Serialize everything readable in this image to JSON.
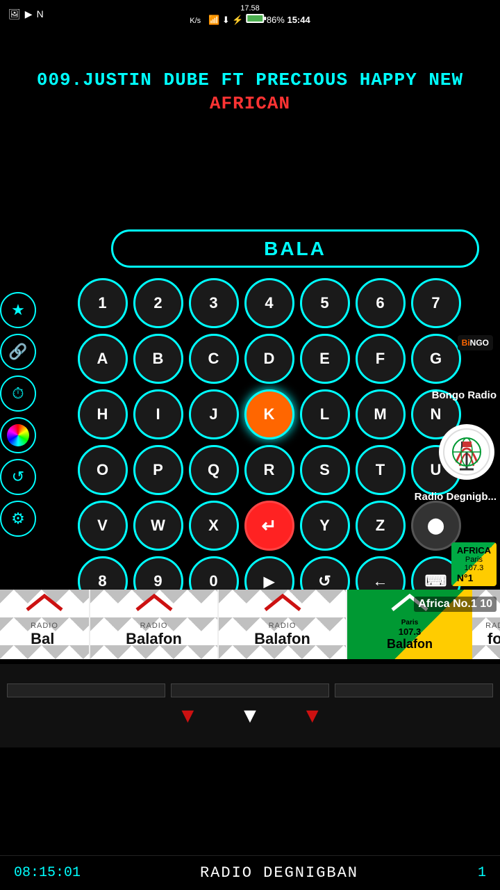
{
  "statusBar": {
    "leftIcons": [
      "photo-icon",
      "music-icon",
      "n-label"
    ],
    "networkSpeed": "17.58\nK/s",
    "wifiIcon": "wifi-icon",
    "downloadIcon": "download-icon",
    "chargeIcon": "charge-icon",
    "batteryPct": "86%",
    "time": "15:44"
  },
  "songTitle": {
    "line1": "009.JUSTIN DUBE FT PRECIOUS   HAPPY NEW",
    "line2": "AFRICAN"
  },
  "searchBar": {
    "text": "BALA"
  },
  "keyboard": {
    "rows": [
      [
        "1",
        "2",
        "3",
        "4",
        "5",
        "6",
        "7"
      ],
      [
        "A",
        "B",
        "C",
        "D",
        "E",
        "F",
        "G"
      ],
      [
        "H",
        "I",
        "J",
        "K",
        "L",
        "M",
        "N"
      ],
      [
        "O",
        "P",
        "Q",
        "R",
        "S",
        "T",
        "U"
      ],
      [
        "V",
        "W",
        "X",
        "↵",
        "Y",
        "Z",
        "⬤"
      ],
      [
        "8",
        "9",
        "0",
        "▶",
        "↺",
        "←",
        "⌨"
      ]
    ]
  },
  "sidebarIcons": {
    "star": "★",
    "share": "⬆",
    "history": "⏱",
    "color": "color-wheel",
    "refresh": "↺",
    "settings": "⚙"
  },
  "stations": [
    {
      "label": "Radio",
      "name": "Balafon"
    },
    {
      "label": "Radio",
      "name": "Balafon"
    },
    {
      "label": "Africa No.1",
      "name": "107.3"
    },
    {
      "label": "Radio",
      "name": "Balafon"
    }
  ],
  "africaNo10Label": "Africa No.1 10",
  "bongo": {
    "badgeText": "BiNGO",
    "radioLabel": "Bongo Radio"
  },
  "radioDegnigban": {
    "label": "Radio Degnigb..."
  },
  "bottomBar": {
    "time": "08:15:01",
    "stationName": "RADIO DEGNIGBAN",
    "endChar": "1"
  }
}
